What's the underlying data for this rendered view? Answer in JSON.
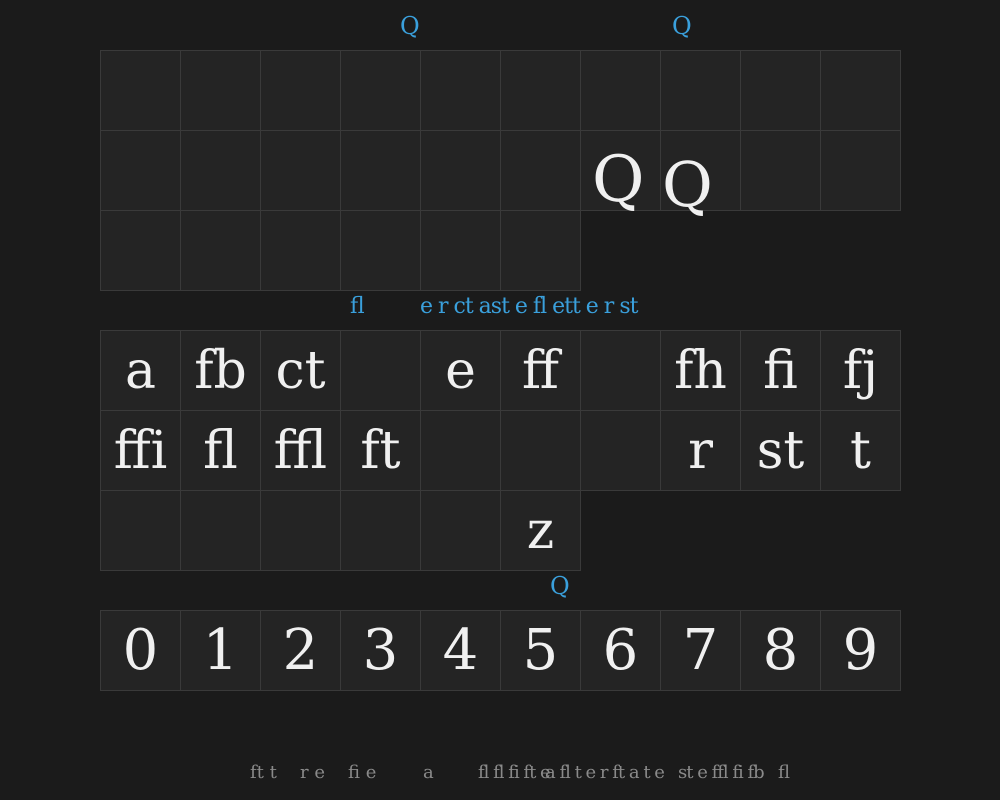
{
  "top_grid": {
    "row1_labels": [
      "Q",
      "Q"
    ],
    "glyphs": [
      "Q",
      "Q"
    ]
  },
  "ligature_label": {
    "left": "fl",
    "right": "e r ct ast e fl ett e r st"
  },
  "letters": {
    "row1": [
      "a",
      "fb",
      "ct",
      "",
      "e",
      "ff",
      "",
      "fh",
      "fi",
      "fj"
    ],
    "row2": [
      "ffi",
      "fl",
      "ffl",
      "ft",
      "",
      "",
      "",
      "r",
      "st",
      "t"
    ],
    "row3": [
      "",
      "",
      "",
      "",
      "",
      "z"
    ]
  },
  "digits_label": "Q",
  "digits": [
    "0",
    "1",
    "2",
    "3",
    "4",
    "5",
    "6",
    "7",
    "8",
    "9"
  ],
  "footer": {
    "items": [
      "ft t",
      "r e",
      "fi e",
      "a",
      "fl fl fi ft e",
      "a fl t e r ft a t e",
      "st e ffl fi fb",
      "fl"
    ]
  }
}
